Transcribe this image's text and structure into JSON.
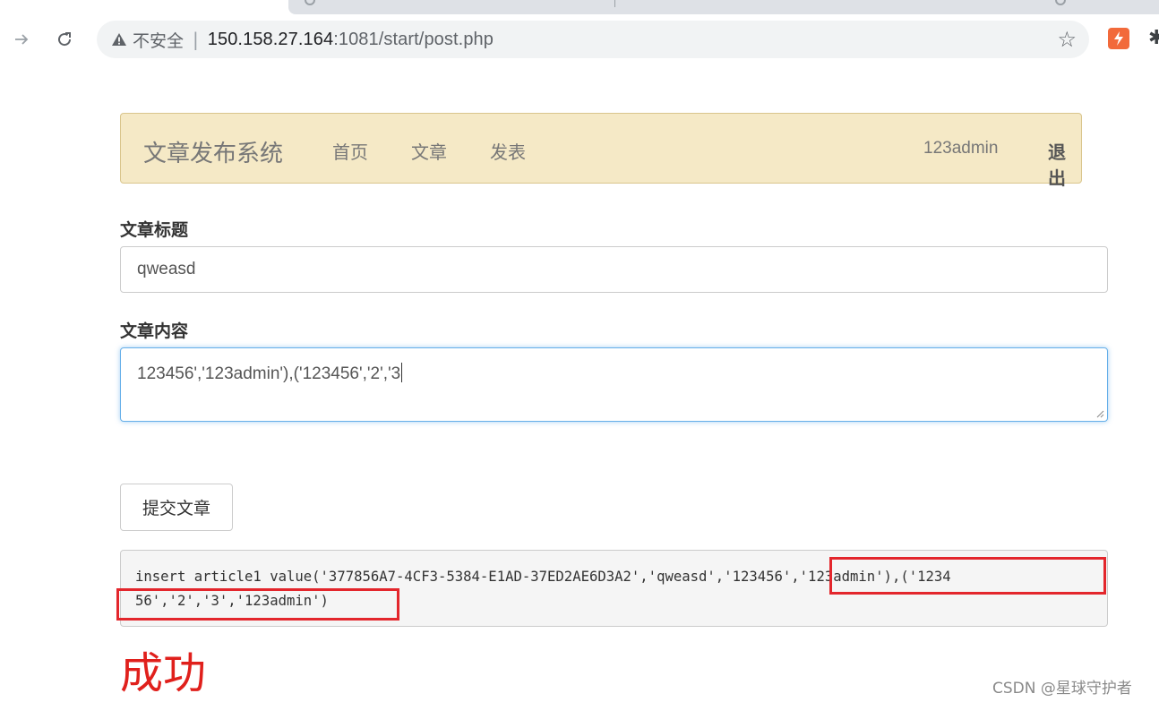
{
  "browser": {
    "security_label": "不安全",
    "separator": "|",
    "url_host": "150.158.27.164",
    "url_rest": ":1081/start/post.php",
    "icons": [
      "back-arrow-icon",
      "reload-icon",
      "warning-icon",
      "star-icon",
      "extension-icon",
      "puzzle-icon"
    ],
    "accent_color": "#f26a3b"
  },
  "navbar": {
    "brand": "文章发布系统",
    "links": [
      "首页",
      "文章",
      "发表"
    ],
    "user": "123admin",
    "logout": "退出",
    "background_color": "#f5e9c6"
  },
  "form": {
    "title_label": "文章标题",
    "title_value": "qweasd",
    "content_label": "文章内容",
    "content_value": "123456','123admin'),('123456','2','3",
    "submit_label": "提交文章"
  },
  "sql_output": {
    "line1": "insert article1 value('377856A7-4CF3-5384-E1AD-37ED2AE6D3A2','qweasd','123456','123admin'),('1234",
    "line2": "56','2','3','123admin')",
    "highlight_color": "#e3262c"
  },
  "result": {
    "text": "成功",
    "color": "#e0201c"
  },
  "watermark": "CSDN @星球守护者"
}
